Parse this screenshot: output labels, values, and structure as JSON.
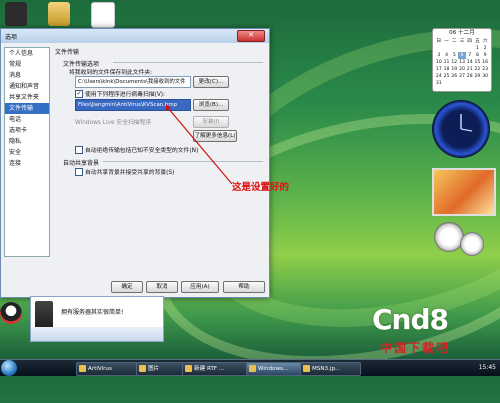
{
  "dialog": {
    "title": "选项",
    "close_symbol": "✕",
    "nav_items": [
      "个人信息",
      "常规",
      "消息",
      "通知和声音",
      "共享文件夹",
      "文件传输",
      "电话",
      "选项卡",
      "隐私",
      "安全",
      "连接"
    ],
    "nav_selected_index": 5,
    "panel_heading": "文件传输",
    "group_options_title": "文件传输选项",
    "save_label": "将我收到的文件保存到此文件夹:",
    "save_path": "C:\\Users\\klnk\\Documents\\我接收到的文件",
    "change_button": "更改(C)...",
    "scan_checkbox_label": "使用下列程序进行病毒扫描(V):",
    "scan_checked": true,
    "scan_path": "Files\\Jiangmin\\AntiVirus\\KVScan.bmp",
    "browse_button": "浏览(B)...",
    "live_scan_label": "Windows Live 安全扫描程序",
    "install_button": "安装(I)",
    "learn_more_button": "了解更多信息(L)",
    "reject_unsafe_label": "自动拒绝传输包括已知不安全类型的文件(N)",
    "reject_checked": false,
    "group_share_title": "自动共享背景",
    "auto_share_label": "自动共享背景并接受共享的背景(S)",
    "share_checked": false,
    "ok_button": "确定",
    "cancel_button": "取消",
    "apply_button": "应用(A)",
    "help_button": "帮助"
  },
  "annotation": "这是设置好的",
  "popup": {
    "text": "拥有服务器其实很简单!"
  },
  "calendar": {
    "header": "06 十二月",
    "weekdays": [
      "日",
      "一",
      "二",
      "三",
      "四",
      "五",
      "六"
    ],
    "days": [
      "",
      "",
      "",
      "",
      "",
      "1",
      "2",
      "3",
      "4",
      "5",
      "6",
      "7",
      "8",
      "9",
      "10",
      "11",
      "12",
      "13",
      "14",
      "15",
      "16",
      "17",
      "18",
      "19",
      "20",
      "21",
      "22",
      "23",
      "24",
      "25",
      "26",
      "27",
      "28",
      "29",
      "30",
      "31"
    ],
    "today": "6"
  },
  "taskbar": {
    "tasks": [
      "ArtiVirus",
      "图片",
      "新建 RTF ...",
      "Windows...",
      "MSN3.jp..."
    ],
    "active_index": 3,
    "clock": "15:45"
  },
  "watermark": {
    "brand": "Cnd8",
    "sub": "中国下载吧"
  },
  "colors": {
    "accent": "#3370c4",
    "annotation": "#d11111",
    "arrow": "#d11111"
  }
}
